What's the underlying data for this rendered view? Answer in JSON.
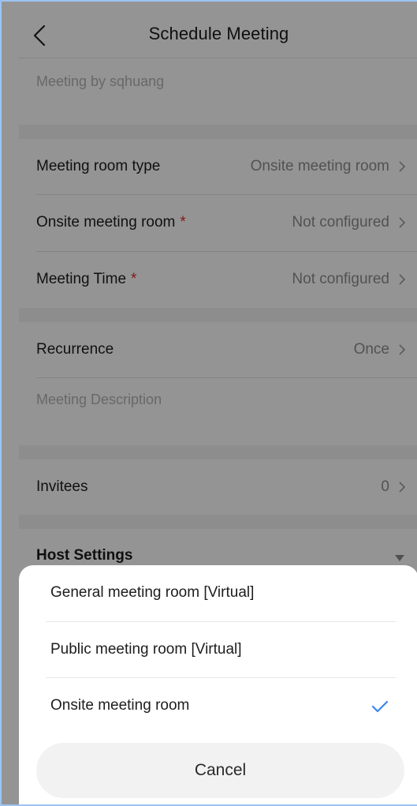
{
  "header": {
    "title": "Schedule Meeting"
  },
  "meeting_name": {
    "placeholder": "Meeting by sqhuang"
  },
  "rows": {
    "room_type": {
      "label": "Meeting room type",
      "value": "Onsite meeting room"
    },
    "onsite_room": {
      "label": "Onsite meeting room",
      "required": "*",
      "value": "Not configured"
    },
    "meeting_time": {
      "label": "Meeting Time",
      "required": "*",
      "value": "Not configured"
    },
    "recurrence": {
      "label": "Recurrence",
      "value": "Once"
    },
    "invitees": {
      "label": "Invitees",
      "value": "0"
    }
  },
  "description": {
    "placeholder": "Meeting Description"
  },
  "host_settings": {
    "label": "Host Settings"
  },
  "sheet": {
    "options": [
      {
        "label": "General meeting room [Virtual]",
        "selected": false
      },
      {
        "label": "Public meeting room [Virtual]",
        "selected": false
      },
      {
        "label": "Onsite meeting room",
        "selected": true
      }
    ],
    "cancel_label": "Cancel"
  },
  "colors": {
    "accent": "#3a86f0",
    "required": "#e0302f",
    "frame_border": "#9cc3f2"
  }
}
